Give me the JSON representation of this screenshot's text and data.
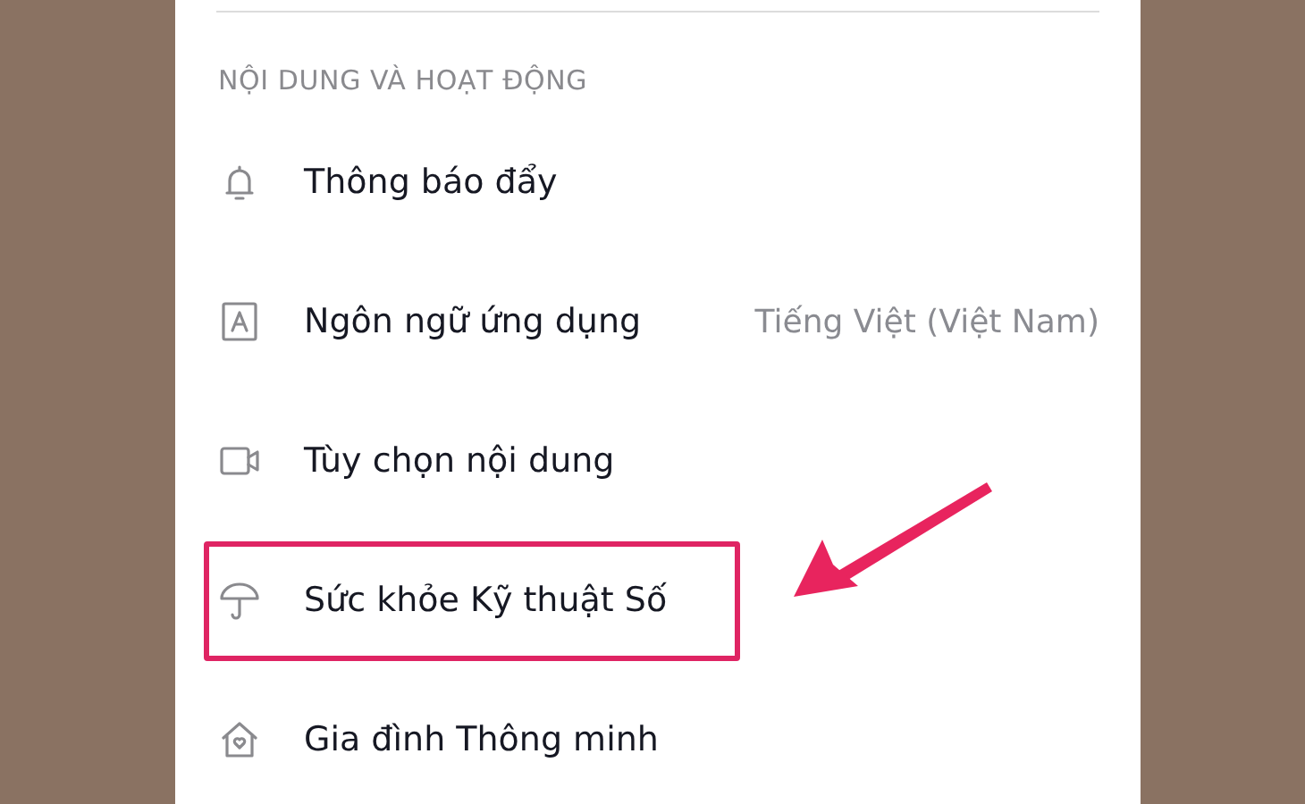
{
  "section_title": "NỘI DUNG VÀ HOẠT ĐỘNG",
  "items": [
    {
      "label": "Thông báo đẩy",
      "highlighted": false
    },
    {
      "label": "Ngôn ngữ ứng dụng",
      "value": "Tiếng Việt (Việt Nam)",
      "highlighted": false
    },
    {
      "label": "Tùy chọn nội dung",
      "highlighted": false
    },
    {
      "label": "Sức khỏe Kỹ thuật Số",
      "highlighted": true
    },
    {
      "label": "Gia đình Thông minh",
      "highlighted": false
    }
  ]
}
